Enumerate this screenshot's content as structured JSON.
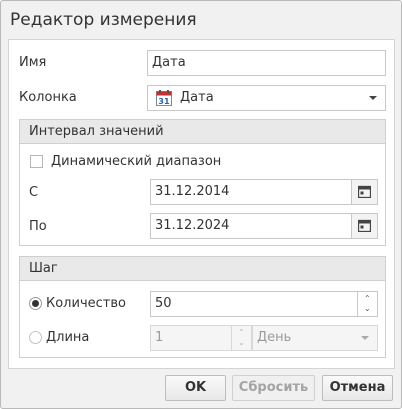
{
  "dialog": {
    "title": "Редактор измерения"
  },
  "fields": {
    "name_label": "Имя",
    "name_value": "Дата",
    "column_label": "Колонка",
    "column_value": "Дата",
    "column_icon": "calendar-31-icon"
  },
  "interval": {
    "header": "Интервал значений",
    "dynamic_label": "Динамический диапазон",
    "dynamic_checked": false,
    "from_label": "С",
    "from_value": "31.12.2014",
    "to_label": "По",
    "to_value": "31.12.2024"
  },
  "step": {
    "header": "Шаг",
    "count_label": "Количество",
    "count_value": "50",
    "count_selected": true,
    "length_label": "Длина",
    "length_value": "1",
    "length_unit": "День",
    "length_selected": false
  },
  "buttons": {
    "ok": "OK",
    "reset": "Сбросить",
    "cancel": "Отмена"
  }
}
